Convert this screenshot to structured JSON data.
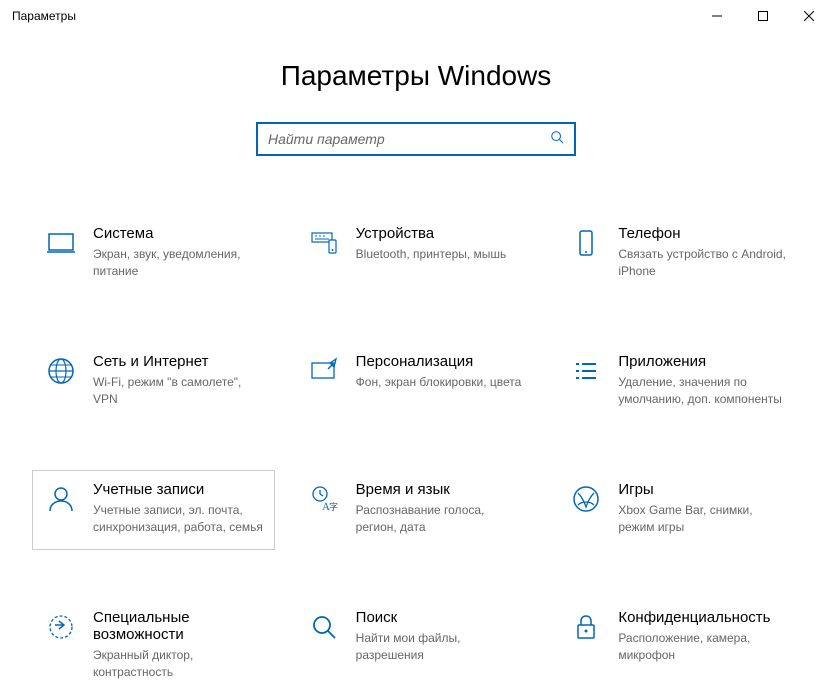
{
  "window": {
    "title": "Параметры"
  },
  "header": {
    "title": "Параметры Windows"
  },
  "search": {
    "placeholder": "Найти параметр"
  },
  "tiles": {
    "system": {
      "title": "Система",
      "desc": "Экран, звук, уведомления, питание"
    },
    "devices": {
      "title": "Устройства",
      "desc": "Bluetooth, принтеры, мышь"
    },
    "phone": {
      "title": "Телефон",
      "desc": "Связать устройство с Android, iPhone"
    },
    "network": {
      "title": "Сеть и Интернет",
      "desc": "Wi-Fi, режим \"в самолете\", VPN"
    },
    "personalization": {
      "title": "Персонализация",
      "desc": "Фон, экран блокировки, цвета"
    },
    "apps": {
      "title": "Приложения",
      "desc": "Удаление, значения по умолчанию, доп. компоненты"
    },
    "accounts": {
      "title": "Учетные записи",
      "desc": "Учетные записи, эл. почта, синхронизация, работа, семья"
    },
    "time": {
      "title": "Время и язык",
      "desc": "Распознавание голоса, регион, дата"
    },
    "gaming": {
      "title": "Игры",
      "desc": "Xbox Game Bar, снимки, режим игры"
    },
    "ease": {
      "title": "Специальные возможности",
      "desc": "Экранный диктор, контрастность"
    },
    "search_tile": {
      "title": "Поиск",
      "desc": "Найти мои файлы, разрешения"
    },
    "privacy": {
      "title": "Конфиденциальность",
      "desc": "Расположение, камера, микрофон"
    }
  }
}
